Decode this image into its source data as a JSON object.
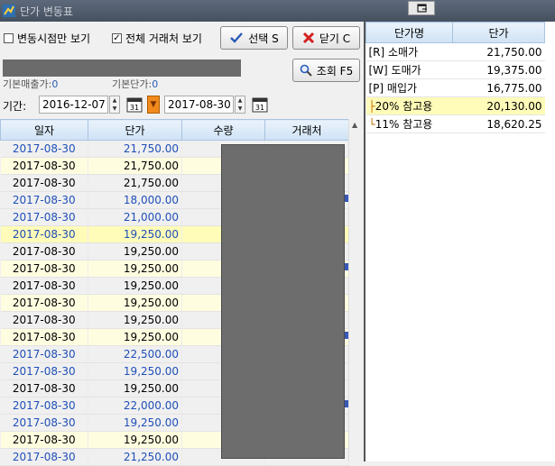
{
  "window": {
    "title": "단가 변동표"
  },
  "toolbar": {
    "only_change_points": {
      "label": "변동시점만 보기",
      "checked": false
    },
    "all_customers": {
      "label": "전체 거래처 보기",
      "checked": true
    },
    "select_button": "선택 S",
    "close_button": "닫기 C",
    "query_button": "조회 F5"
  },
  "summary": {
    "base_sales_label": "기본매출가:",
    "base_sales_value": "0",
    "base_purchase_label": "기본단가:",
    "base_purchase_value": "0"
  },
  "period": {
    "label": "기간:",
    "from": "2016-12-07",
    "to": "2017-08-30",
    "calendar_day": "31"
  },
  "grid": {
    "columns": [
      "일자",
      "단가",
      "수량",
      "거래처"
    ],
    "rows": [
      {
        "date": "2017-08-30",
        "price": "21,750.00",
        "style": "blue"
      },
      {
        "date": "2017-08-30",
        "price": "21,750.00",
        "style": "yel"
      },
      {
        "date": "2017-08-30",
        "price": "21,750.00",
        "style": ""
      },
      {
        "date": "2017-08-30",
        "price": "18,000.00",
        "style": "blue"
      },
      {
        "date": "2017-08-30",
        "price": "21,000.00",
        "style": "blue"
      },
      {
        "date": "2017-08-30",
        "price": "19,250.00",
        "style": "blue sel"
      },
      {
        "date": "2017-08-30",
        "price": "19,250.00",
        "style": ""
      },
      {
        "date": "2017-08-30",
        "price": "19,250.00",
        "style": "yel"
      },
      {
        "date": "2017-08-30",
        "price": "19,250.00",
        "style": ""
      },
      {
        "date": "2017-08-30",
        "price": "19,250.00",
        "style": "yel"
      },
      {
        "date": "2017-08-30",
        "price": "19,250.00",
        "style": ""
      },
      {
        "date": "2017-08-30",
        "price": "19,250.00",
        "style": "yel"
      },
      {
        "date": "2017-08-30",
        "price": "22,500.00",
        "style": "blue"
      },
      {
        "date": "2017-08-30",
        "price": "19,250.00",
        "style": "blue"
      },
      {
        "date": "2017-08-30",
        "price": "19,250.00",
        "style": ""
      },
      {
        "date": "2017-08-30",
        "price": "22,000.00",
        "style": "blue"
      },
      {
        "date": "2017-08-30",
        "price": "19,250.00",
        "style": "blue"
      },
      {
        "date": "2017-08-30",
        "price": "19,250.00",
        "style": "yel"
      },
      {
        "date": "2017-08-30",
        "price": "21,250.00",
        "style": "blue"
      }
    ]
  },
  "price_table": {
    "columns": [
      "단가명",
      "단가"
    ],
    "rows": [
      {
        "name": "[R] 소매가",
        "value": "21,750.00",
        "tree": "",
        "highlight": false
      },
      {
        "name": "[W] 도매가",
        "value": "19,375.00",
        "tree": "",
        "highlight": false
      },
      {
        "name": "[P] 매입가",
        "value": "16,775.00",
        "tree": "",
        "highlight": false
      },
      {
        "name": "20% 참고용",
        "value": "20,130.00",
        "tree": "├",
        "highlight": true
      },
      {
        "name": "11% 참고용",
        "value": "18,620.25",
        "tree": "└",
        "highlight": false
      }
    ]
  }
}
